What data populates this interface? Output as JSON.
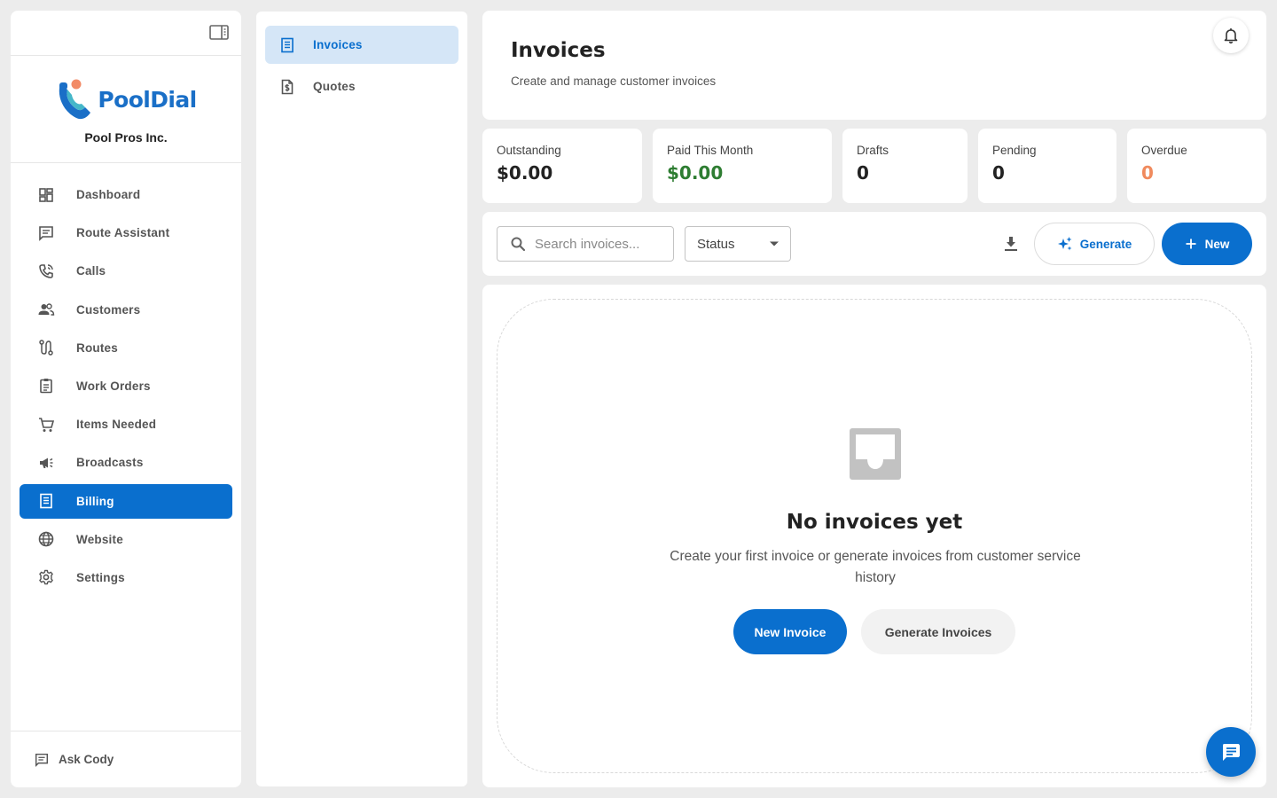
{
  "brand": {
    "logo_text": "PoolDial",
    "company_name": "Pool Pros Inc.",
    "accent_color": "#0a6fce"
  },
  "sidebar": {
    "items": [
      {
        "label": "Dashboard",
        "icon": "dashboard-icon"
      },
      {
        "label": "Route Assistant",
        "icon": "chat-icon"
      },
      {
        "label": "Calls",
        "icon": "phone-icon"
      },
      {
        "label": "Customers",
        "icon": "people-icon"
      },
      {
        "label": "Routes",
        "icon": "route-icon"
      },
      {
        "label": "Work Orders",
        "icon": "clipboard-icon"
      },
      {
        "label": "Items Needed",
        "icon": "cart-icon"
      },
      {
        "label": "Broadcasts",
        "icon": "megaphone-icon"
      },
      {
        "label": "Billing",
        "icon": "receipt-icon",
        "active": true
      },
      {
        "label": "Website",
        "icon": "globe-icon"
      },
      {
        "label": "Settings",
        "icon": "gear-icon"
      }
    ],
    "ask_label": "Ask Cody"
  },
  "subnav": {
    "items": [
      {
        "label": "Invoices",
        "icon": "receipt-icon",
        "active": true
      },
      {
        "label": "Quotes",
        "icon": "dollar-document-icon"
      }
    ]
  },
  "header": {
    "title": "Invoices",
    "subtitle": "Create and manage customer invoices"
  },
  "stats": [
    {
      "label": "Outstanding",
      "value": "$0.00",
      "color": "#222222"
    },
    {
      "label": "Paid This Month",
      "value": "$0.00",
      "color": "#2e7d32"
    },
    {
      "label": "Drafts",
      "value": "0",
      "color": "#222222"
    },
    {
      "label": "Pending",
      "value": "0",
      "color": "#222222"
    },
    {
      "label": "Overdue",
      "value": "0",
      "color": "#f08a5d"
    }
  ],
  "toolbar": {
    "search_placeholder": "Search invoices...",
    "status_label": "Status",
    "generate_label": "Generate",
    "new_label": "New"
  },
  "empty": {
    "title": "No invoices yet",
    "description": "Create your first invoice or generate invoices from customer service history",
    "new_invoice_label": "New Invoice",
    "generate_invoices_label": "Generate Invoices"
  }
}
